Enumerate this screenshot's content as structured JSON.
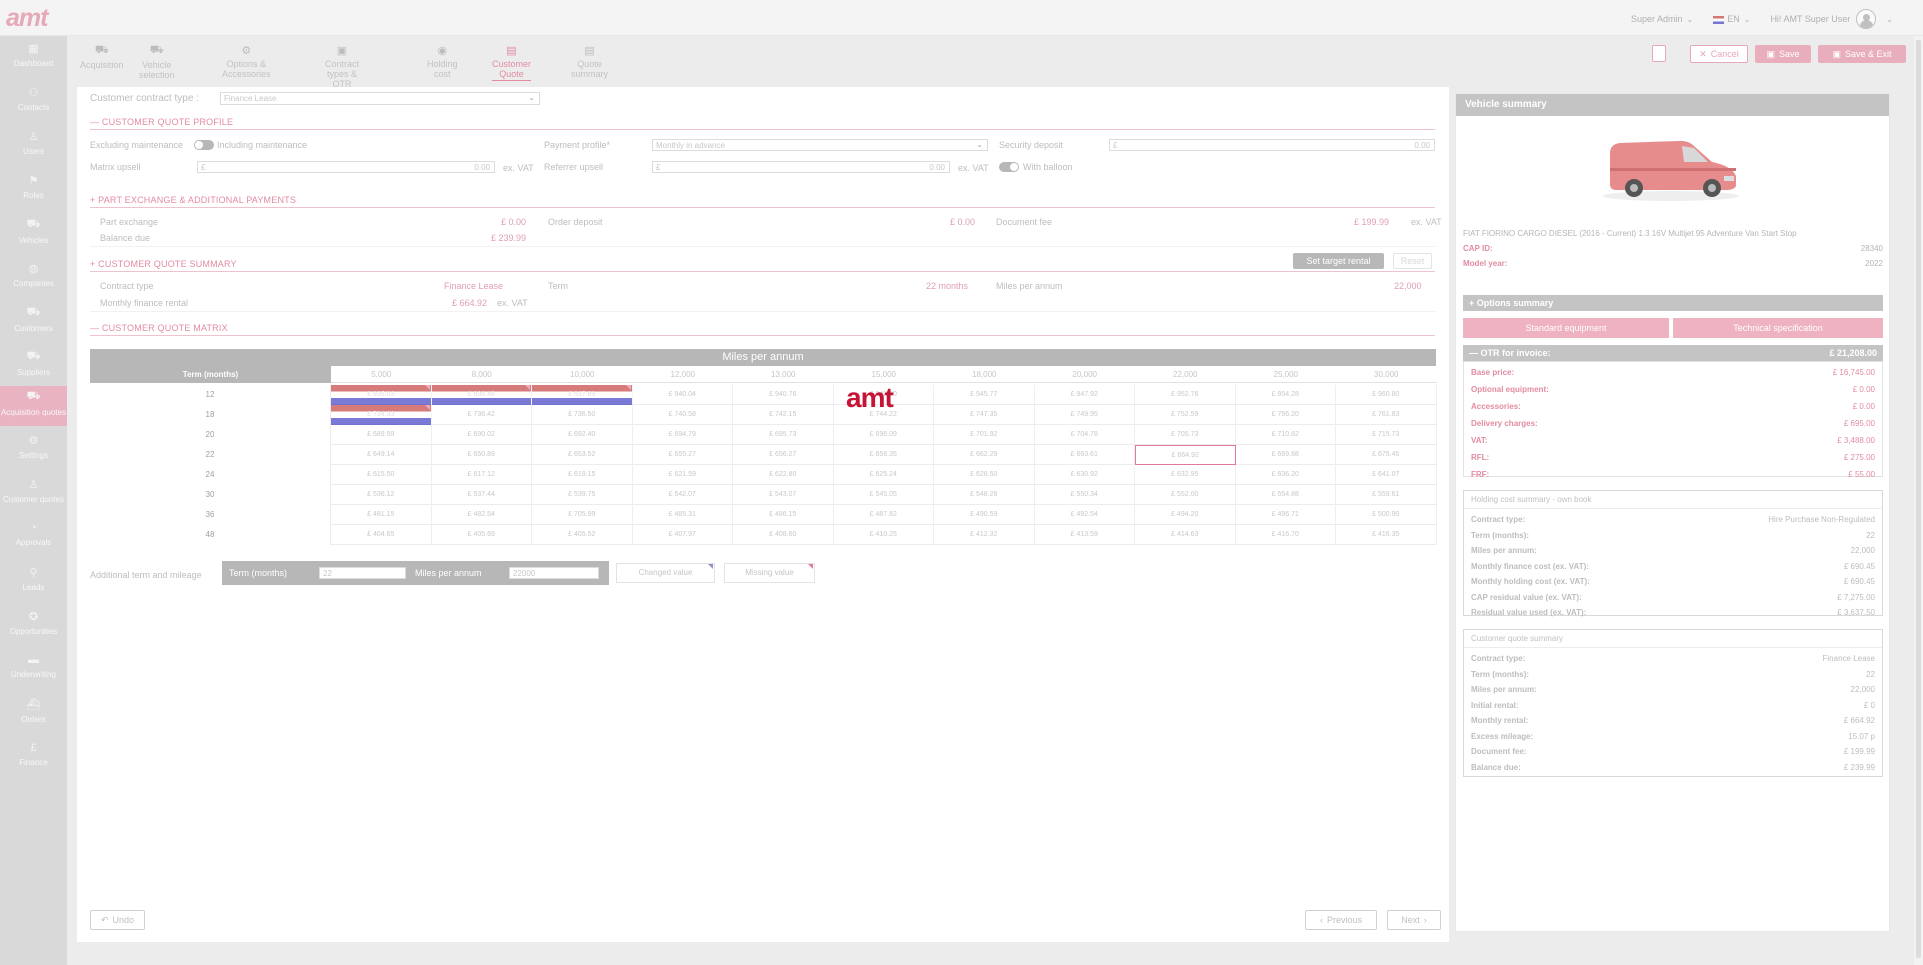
{
  "app": {
    "logo_text": "amt"
  },
  "topbar": {
    "role": "Super Admin",
    "language": "EN",
    "greeting": "Hi! AMT Super User"
  },
  "sidebar": {
    "items": [
      {
        "label": "Dashboard",
        "icon": "dashboard-icon"
      },
      {
        "label": "Contacts",
        "icon": "contacts-icon"
      },
      {
        "label": "Users",
        "icon": "users-icon"
      },
      {
        "label": "Roles",
        "icon": "roles-icon"
      },
      {
        "label": "Vehicles",
        "icon": "vehicles-icon"
      },
      {
        "label": "Companies",
        "icon": "companies-icon"
      },
      {
        "label": "Customers",
        "icon": "customers-icon"
      },
      {
        "label": "Suppliers",
        "icon": "suppliers-icon"
      },
      {
        "label": "Acquisition quotes",
        "icon": "acquisition-quotes-icon"
      },
      {
        "label": "Settings",
        "icon": "settings-icon"
      },
      {
        "label": "Customer quotes",
        "icon": "customer-quotes-icon"
      },
      {
        "label": "Approvals",
        "icon": "approvals-icon"
      },
      {
        "label": "Leads",
        "icon": "leads-icon"
      },
      {
        "label": "Opportunities",
        "icon": "opportunities-icon"
      },
      {
        "label": "Underwriting",
        "icon": "underwriting-icon"
      },
      {
        "label": "Orders",
        "icon": "orders-icon"
      },
      {
        "label": "Finance",
        "icon": "finance-icon"
      }
    ]
  },
  "steps": [
    "Acquisition",
    "Vehicle selection",
    "Options & Accessories",
    "Contract types & OTR",
    "Holding cost",
    "Customer Quote",
    "Quote summary"
  ],
  "toolbar": {
    "cancel": "Cancel",
    "save": "Save",
    "save_exit": "Save & Exit"
  },
  "form": {
    "contract_type_label": "Customer contract type :",
    "contract_type_value": "Finance Lease",
    "profile_title": "CUSTOMER QUOTE PROFILE",
    "excluding_maintenance": "Excluding maintenance",
    "including_maintenance": "Including maintenance",
    "payment_profile_label": "Payment profile*",
    "payment_profile_value": "Monthly in advance",
    "security_deposit_label": "Security deposit",
    "security_deposit_prefix": "£",
    "security_deposit_value": "0.00",
    "matrix_upsell_label": "Matrix upsell",
    "matrix_upsell_prefix": "£",
    "matrix_upsell_value": "0.00",
    "exvat": "ex. VAT",
    "referrer_upsell_label": "Referrer upsell",
    "referrer_upsell_prefix": "£",
    "referrer_upsell_value": "0.00",
    "with_balloon": "With balloon",
    "part_exchange_title": "PART EXCHANGE & ADDITIONAL PAYMENTS",
    "part_exchange_label": "Part exchange",
    "part_exchange_value": "£ 0.00",
    "order_deposit_label": "Order deposit",
    "order_deposit_value": "£ 0.00",
    "document_fee_label": "Document fee",
    "document_fee_value": "£ 199.99",
    "balance_due_label": "Balance due",
    "balance_due_value": "£ 239.99",
    "summary_title": "CUSTOMER QUOTE SUMMARY",
    "set_target_rental": "Set target rental",
    "reset": "Reset",
    "contract_type2_label": "Contract type",
    "contract_type2_value": "Finance Lease",
    "term_label": "Term",
    "term_value": "22 months",
    "miles_label": "Miles per annum",
    "miles_value": "22,000",
    "monthly_rental_label": "Monthly finance rental",
    "monthly_rental_value": "£ 664.92",
    "matrix_title": "CUSTOMER QUOTE MATRIX"
  },
  "matrix": {
    "header": "Miles per annum",
    "term_header": "Term (months)",
    "columns": [
      "5,000",
      "8,000",
      "10,000",
      "12,000",
      "13,000",
      "15,000",
      "18,000",
      "20,000",
      "22,000",
      "25,000",
      "30,000"
    ],
    "rows": [
      {
        "term": "12",
        "values": [
          "£ 935.03",
          "£ 936.48",
          "£ 937.89",
          "£ 940.04",
          "£ 940.76",
          "£ 942.90",
          "£ 945.77",
          "£ 947.92",
          "£ 952.76",
          "£ 954.28",
          "£ 960.80"
        ],
        "flags": [
          0,
          1,
          2
        ]
      },
      {
        "term": "18",
        "values": [
          "£ 734.33",
          "£ 736.42",
          "£ 736.50",
          "£ 740.58",
          "£ 742.15",
          "£ 744.22",
          "£ 747.35",
          "£ 749.95",
          "£ 752.59",
          "£ 756.20",
          "£ 761.83"
        ],
        "flags": [
          0
        ]
      },
      {
        "term": "20",
        "values": [
          "£ 689.59",
          "£ 690.02",
          "£ 692.40",
          "£ 694.79",
          "£ 695.73",
          "£ 696.09",
          "£ 701.92",
          "£ 704.78",
          "£ 705.73",
          "£ 710.62",
          "£ 715.73"
        ],
        "flags": []
      },
      {
        "term": "22",
        "values": [
          "£ 649.14",
          "£ 650.89",
          "£ 653.52",
          "£ 655.27",
          "£ 656.27",
          "£ 658.35",
          "£ 662.29",
          "£ 663.61",
          "£ 664.92",
          "£ 669.88",
          "£ 675.45"
        ],
        "flags": []
      },
      {
        "term": "24",
        "values": [
          "£ 615.50",
          "£ 617.12",
          "£ 619.15",
          "£ 621.59",
          "£ 622.80",
          "£ 625.24",
          "£ 628.50",
          "£ 630.92",
          "£ 632.95",
          "£ 636.20",
          "£ 641.07"
        ],
        "flags": []
      },
      {
        "term": "30",
        "values": [
          "£ 536.12",
          "£ 537.44",
          "£ 539.75",
          "£ 542.07",
          "£ 543.07",
          "£ 545.05",
          "£ 548.26",
          "£ 550.34",
          "£ 552.00",
          "£ 554.88",
          "£ 559.61"
        ],
        "flags": []
      },
      {
        "term": "36",
        "values": [
          "£ 481.15",
          "£ 482.54",
          "£ 705.99",
          "£ 485.31",
          "£ 486.15",
          "£ 487.82",
          "£ 490.59",
          "£ 492.54",
          "£ 494.20",
          "£ 496.71",
          "£ 500.90"
        ],
        "flags": []
      },
      {
        "term": "48",
        "values": [
          "£ 404.65",
          "£ 405.69",
          "£ 405.52",
          "£ 407.97",
          "£ 408.60",
          "£ 410.25",
          "£ 412.32",
          "£ 413.59",
          "£ 414.63",
          "£ 416.70",
          "£ 416.35"
        ],
        "flags": []
      }
    ],
    "selected": {
      "row": 3,
      "col": 8
    },
    "watermark": "amt"
  },
  "additional": {
    "label": "Additional term and mileage",
    "term_label": "Term (months)",
    "term_value": "22",
    "miles_label": "Miles per annum",
    "miles_value": "22000",
    "changed_value": "Changed value",
    "missing_value": "Missing value"
  },
  "footer": {
    "undo": "Undo",
    "previous": "Previous",
    "next": "Next"
  },
  "vehicle_summary": {
    "title": "Vehicle summary",
    "description": "FIAT FIORINO CARGO DIESEL (2016 - Current) 1.3 16V Multijet 95 Adventure Van Start Stop",
    "cap_id_label": "CAP ID:",
    "cap_id_value": "28340",
    "model_year_label": "Model year:",
    "model_year_value": "2022",
    "options_summary": "Options summary",
    "standard_equipment": "Standard equipment",
    "technical_specification": "Technical specification",
    "otr_label": "OTR for invoice:",
    "otr_value": "£ 21,208.00",
    "otr_items": [
      {
        "k": "Base price:",
        "v": "£ 16,745.00"
      },
      {
        "k": "Optional equipment:",
        "v": "£ 0.00"
      },
      {
        "k": "Accessories:",
        "v": "£ 0.00"
      },
      {
        "k": "Delivery charges:",
        "v": "£ 695.00"
      },
      {
        "k": "VAT:",
        "v": "£ 3,488.00"
      },
      {
        "k": "RFL:",
        "v": "£ 275.00"
      },
      {
        "k": "FRF:",
        "v": "£ 55.00"
      }
    ],
    "holding_title": "Holding cost summary - own book",
    "holding_items": [
      {
        "k": "Contract type:",
        "v": "Hire Purchase Non-Regulated"
      },
      {
        "k": "Term (months):",
        "v": "22"
      },
      {
        "k": "Miles per annum:",
        "v": "22,000"
      },
      {
        "k": "Monthly finance cost (ex. VAT):",
        "v": "£ 690.45"
      },
      {
        "k": "Monthly holding cost (ex. VAT):",
        "v": "£ 690.45"
      },
      {
        "k": "CAP residual value (ex. VAT):",
        "v": "£ 7,275.00"
      },
      {
        "k": "Residual value used (ex. VAT):",
        "v": "£ 3,637.50"
      }
    ],
    "customer_title": "Customer quote summary",
    "customer_items": [
      {
        "k": "Contract type:",
        "v": "Finance Lease"
      },
      {
        "k": "Term (months):",
        "v": "22"
      },
      {
        "k": "Miles per annum:",
        "v": "22,000"
      },
      {
        "k": "Initial rental:",
        "v": "£ 0"
      },
      {
        "k": "Monthly rental:",
        "v": "£ 664.92"
      },
      {
        "k": "Excess mileage:",
        "v": "15.07 p"
      },
      {
        "k": "Document fee:",
        "v": "£ 199.99"
      },
      {
        "k": "Balance due:",
        "v": "£ 239.99"
      }
    ]
  }
}
